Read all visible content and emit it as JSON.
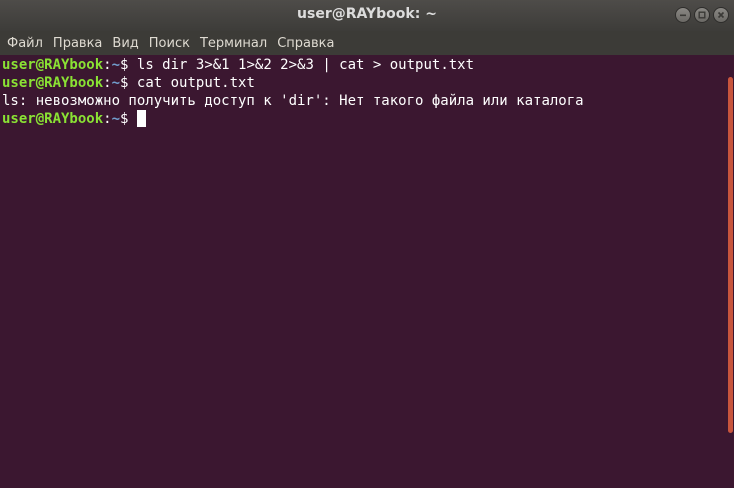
{
  "window": {
    "title": "user@RAYbook: ~"
  },
  "menu": {
    "items": [
      "Файл",
      "Правка",
      "Вид",
      "Поиск",
      "Терминал",
      "Справка"
    ]
  },
  "terminal": {
    "lines": [
      {
        "user": "user@RAYbook",
        "colon": ":",
        "path": "~",
        "sign": "$ ",
        "text": "ls dir 3>&1 1>&2 2>&3 | cat > output.txt"
      },
      {
        "user": "user@RAYbook",
        "colon": ":",
        "path": "~",
        "sign": "$ ",
        "text": "cat output.txt"
      },
      {
        "text": "ls: невозможно получить доступ к 'dir': Нет такого файла или каталога"
      },
      {
        "user": "user@RAYbook",
        "colon": ":",
        "path": "~",
        "sign": "$ ",
        "text": ""
      }
    ]
  },
  "colors": {
    "background": "#3b1730",
    "prompt_user": "#8ae234",
    "prompt_path": "#729fcf",
    "text": "#ffffff",
    "scrollbar": "#c8553d"
  },
  "icons": [
    "minimize-icon",
    "maximize-icon",
    "close-icon"
  ]
}
